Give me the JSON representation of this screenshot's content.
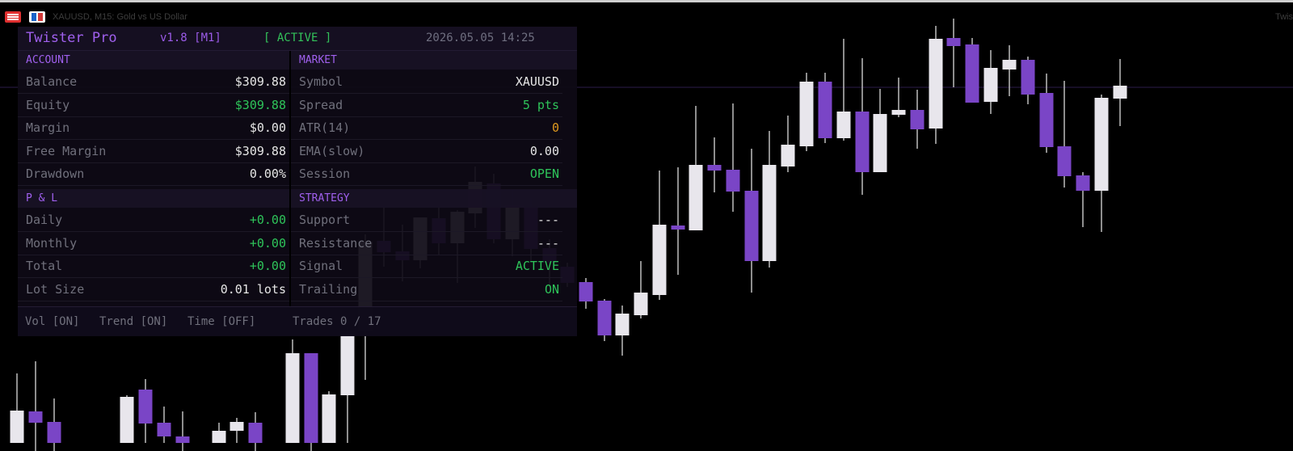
{
  "window": {
    "title": "XAUUSD, M15:  Gold vs US Dollar",
    "right_text": "Twis"
  },
  "panel": {
    "brand": "Twister Pro",
    "version": "v1.8 [M1]",
    "status": "[ ACTIVE ]",
    "datetime": "2026.05.05 14:25",
    "account": {
      "heading": "ACCOUNT",
      "rows": [
        {
          "label": "Balance",
          "value": "$309.88",
          "tone": "white"
        },
        {
          "label": "Equity",
          "value": "$309.88",
          "tone": "green"
        },
        {
          "label": "Margin",
          "value": "$0.00",
          "tone": "white"
        },
        {
          "label": "Free Margin",
          "value": "$309.88",
          "tone": "white"
        },
        {
          "label": "Drawdown",
          "value": "0.00%",
          "tone": "white"
        }
      ]
    },
    "market": {
      "heading": "MARKET",
      "rows": [
        {
          "label": "Symbol",
          "value": "XAUUSD",
          "tone": "white"
        },
        {
          "label": "Spread",
          "value": "5 pts",
          "tone": "green"
        },
        {
          "label": "ATR(14)",
          "value": "0",
          "tone": "orange"
        },
        {
          "label": "EMA(slow)",
          "value": "0.00",
          "tone": "white"
        },
        {
          "label": "Session",
          "value": "OPEN",
          "tone": "green"
        }
      ]
    },
    "pnl": {
      "heading": "P & L",
      "rows": [
        {
          "label": "Daily",
          "value": "+0.00",
          "tone": "green"
        },
        {
          "label": "Monthly",
          "value": "+0.00",
          "tone": "green"
        },
        {
          "label": "Total",
          "value": "+0.00",
          "tone": "green"
        },
        {
          "label": "Lot Size",
          "value": "0.01 lots",
          "tone": "white"
        }
      ]
    },
    "strategy": {
      "heading": "STRATEGY",
      "rows": [
        {
          "label": "Support",
          "value": "---",
          "tone": "white"
        },
        {
          "label": "Resistance",
          "value": "---",
          "tone": "white"
        },
        {
          "label": "Signal",
          "value": "ACTIVE",
          "tone": "green"
        },
        {
          "label": "Trailing",
          "value": "ON",
          "tone": "green"
        }
      ]
    },
    "footer": {
      "vol": "Vol [ON]",
      "trend": "Trend [ON]",
      "time": "Time [OFF]",
      "trades": "Trades 0 / 17"
    }
  },
  "colors": {
    "bull": "#e8e6ec",
    "bear": "#7a45c6",
    "price_line": "#2b1c4a",
    "accent": "#a060ee",
    "positive": "#2ec45a",
    "warning": "#e09a1e"
  }
}
